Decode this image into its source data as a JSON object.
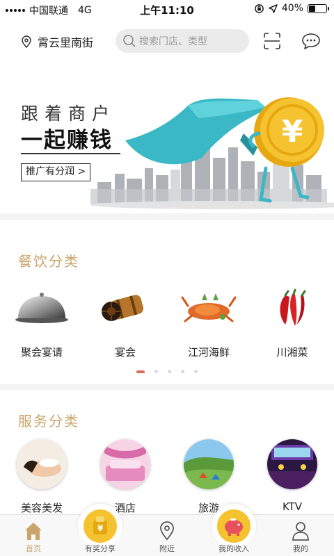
{
  "status_bar": {
    "carrier": "中国联通",
    "network": "4G",
    "time": "上午11:10",
    "battery_percent": "40%",
    "battery_level": 0.4
  },
  "header": {
    "location": "霄云里南街",
    "search_placeholder": "搜索门店、类型",
    "icons": [
      "location-pin-icon",
      "search-icon",
      "scan-icon",
      "message-icon"
    ]
  },
  "banner": {
    "line1": "跟着商户",
    "line2": "一起赚钱",
    "button": "推广有分润 >",
    "coin_symbol": "¥"
  },
  "dining": {
    "title": "餐饮分类",
    "items": [
      {
        "label": "聚会宴请",
        "icon": "cloche-icon"
      },
      {
        "label": "宴会",
        "icon": "wine-barrel-icon"
      },
      {
        "label": "江河海鲜",
        "icon": "crab-icon"
      },
      {
        "label": "川湘菜",
        "icon": "chili-icon"
      }
    ],
    "page_count": 5,
    "active_page": 1
  },
  "services": {
    "title": "服务分类",
    "items": [
      {
        "label": "美容美发"
      },
      {
        "label": "酒店"
      },
      {
        "label": "旅游"
      },
      {
        "label": "KTV"
      }
    ]
  },
  "tabbar": {
    "tabs": [
      {
        "label": "首页",
        "icon": "home-icon",
        "active": true
      },
      {
        "label": "有奖分享",
        "icon": "gift-coin-icon",
        "active": false
      },
      {
        "label": "附近",
        "icon": "map-pin-icon",
        "active": false
      },
      {
        "label": "我的收入",
        "icon": "piggy-bank-icon",
        "active": false
      },
      {
        "label": "我的",
        "icon": "user-icon",
        "active": false
      }
    ]
  },
  "colors": {
    "accent_gold": "#c8a56a",
    "coin_yellow": "#f5c230",
    "teal": "#3bb8c6",
    "dot_active": "#d96b5a"
  }
}
